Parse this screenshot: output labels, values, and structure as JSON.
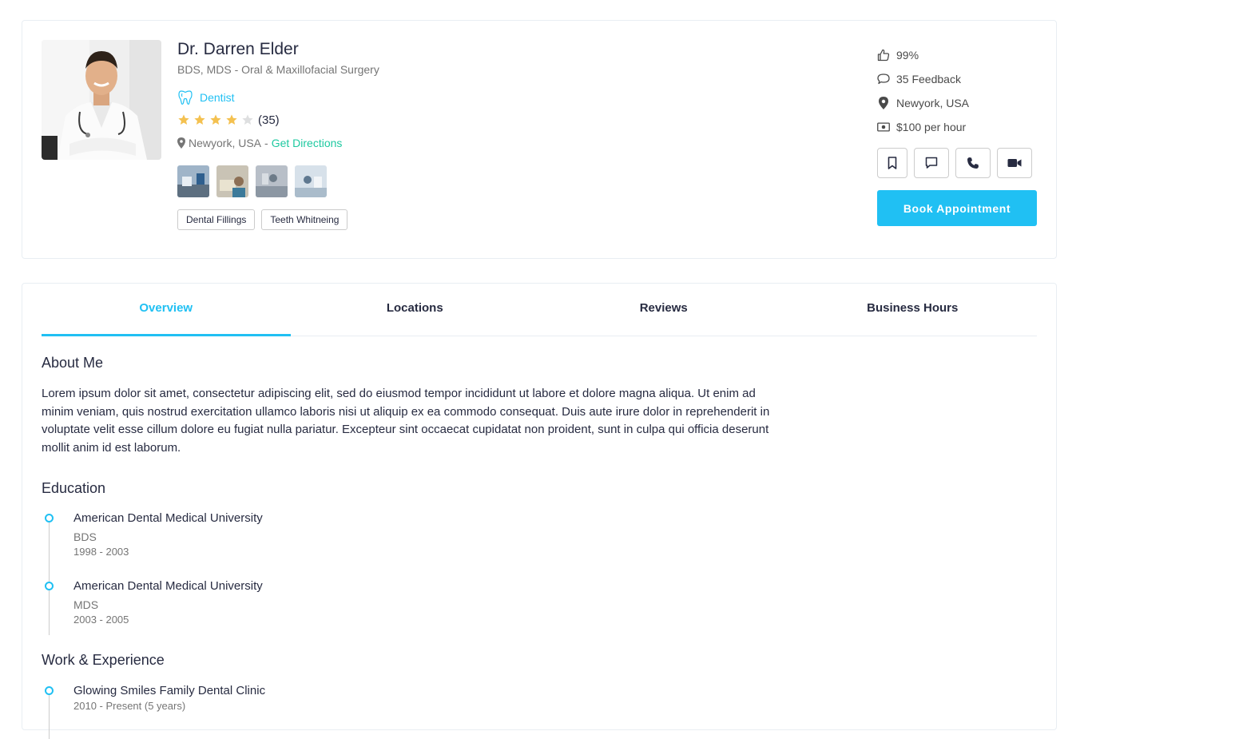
{
  "doctor": {
    "name": "Dr. Darren Elder",
    "speciality": "BDS, MDS - Oral & Maxillofacial Surgery",
    "department": "Dentist",
    "rating_count": "(35)",
    "rating": 4,
    "rating_max": 5,
    "location": "Newyork, USA",
    "location_sep": "-",
    "directions_link": "Get Directions",
    "tags": [
      "Dental Fillings",
      "Teeth Whitneing"
    ]
  },
  "stats": {
    "likes": "99%",
    "feedback": "35 Feedback",
    "location": "Newyork, USA",
    "price": "$100 per hour"
  },
  "actions": {
    "book_label": "Book Appointment"
  },
  "tabs": [
    {
      "label": "Overview",
      "active": true
    },
    {
      "label": "Locations",
      "active": false
    },
    {
      "label": "Reviews",
      "active": false
    },
    {
      "label": "Business Hours",
      "active": false
    }
  ],
  "about": {
    "title": "About Me",
    "text": "Lorem ipsum dolor sit amet, consectetur adipiscing elit, sed do eiusmod tempor incididunt ut labore et dolore magna aliqua. Ut enim ad minim veniam, quis nostrud exercitation ullamco laboris nisi ut aliquip ex ea commodo consequat. Duis aute irure dolor in reprehenderit in voluptate velit esse cillum dolore eu fugiat nulla pariatur. Excepteur sint occaecat cupidatat non proident, sunt in culpa qui officia deserunt mollit anim id est laborum."
  },
  "education": {
    "title": "Education",
    "items": [
      {
        "name": "American Dental Medical University",
        "degree": "BDS",
        "years": "1998 - 2003"
      },
      {
        "name": "American Dental Medical University",
        "degree": "MDS",
        "years": "2003 - 2005"
      }
    ]
  },
  "experience": {
    "title": "Work & Experience",
    "items": [
      {
        "name": "Glowing Smiles Family Dental Clinic",
        "years": "2010 - Present (5 years)"
      }
    ]
  },
  "colors": {
    "accent": "#20c0f3",
    "green_link": "#1ec9a0",
    "star": "#f4c150",
    "star_empty": "#dedfe0"
  }
}
